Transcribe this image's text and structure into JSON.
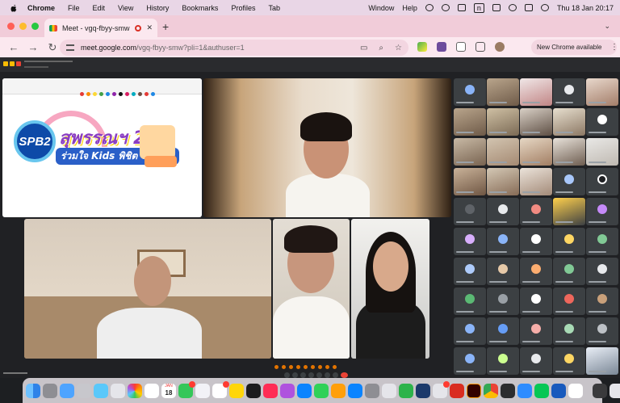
{
  "menubar": {
    "app": "Chrome",
    "items": [
      "File",
      "Edit",
      "View",
      "History",
      "Bookmarks",
      "Profiles",
      "Tab"
    ],
    "right_items": [
      "Window",
      "Help"
    ],
    "input_indicator": "n",
    "clock": "Thu 18 Jan  20:17"
  },
  "browser": {
    "tab_title": "Meet - vgq-fbyy-smw",
    "tab_close": "✕",
    "new_tab": "+",
    "url_host": "meet.google.com",
    "url_path": "/vgq-fbyy-smw?pli=1&authuser=1",
    "new_chrome_label": "New Chrome available",
    "menu_dots": "⋮",
    "nav_back": "←",
    "nav_forward": "→",
    "nav_reload": "↻"
  },
  "slide": {
    "logo_text": "SPB2",
    "headline": "สุพรรณฯ 2",
    "subline": "ร่วมใจ Kids พิชิต O-NET"
  },
  "colors": {
    "menubar_bg": "#e9d6e6",
    "tabstrip_bg": "#f1ccd9",
    "toolbar_bg": "#fbe8ef",
    "meet_bg": "#202124",
    "recording_red": "#d93025"
  },
  "icons": {
    "traffic_lights": [
      "close-icon",
      "minimize-icon",
      "zoom-icon"
    ],
    "toolbar": [
      "extensions-icon",
      "profile-icon",
      "sidepanel-icon",
      "avatar-icon"
    ],
    "dock": [
      "finder-icon",
      "launchpad-icon",
      "safari-icon",
      "messages-icon",
      "mail-icon",
      "photos-icon",
      "calendar-icon",
      "reminders-icon",
      "notes-icon",
      "music-icon",
      "podcasts-icon",
      "tv-icon",
      "keynote-icon",
      "numbers-icon",
      "pages-icon",
      "appstore-icon",
      "settings-icon",
      "chrome-icon",
      "word-icon",
      "powerpoint-icon",
      "acrobat-icon",
      "illustrator-icon",
      "zoom-icon",
      "line-icon",
      "outlook-icon",
      "terminal-icon",
      "trash-icon"
    ]
  },
  "dock": {
    "calendar_month": "JAN",
    "calendar_day": "18"
  }
}
